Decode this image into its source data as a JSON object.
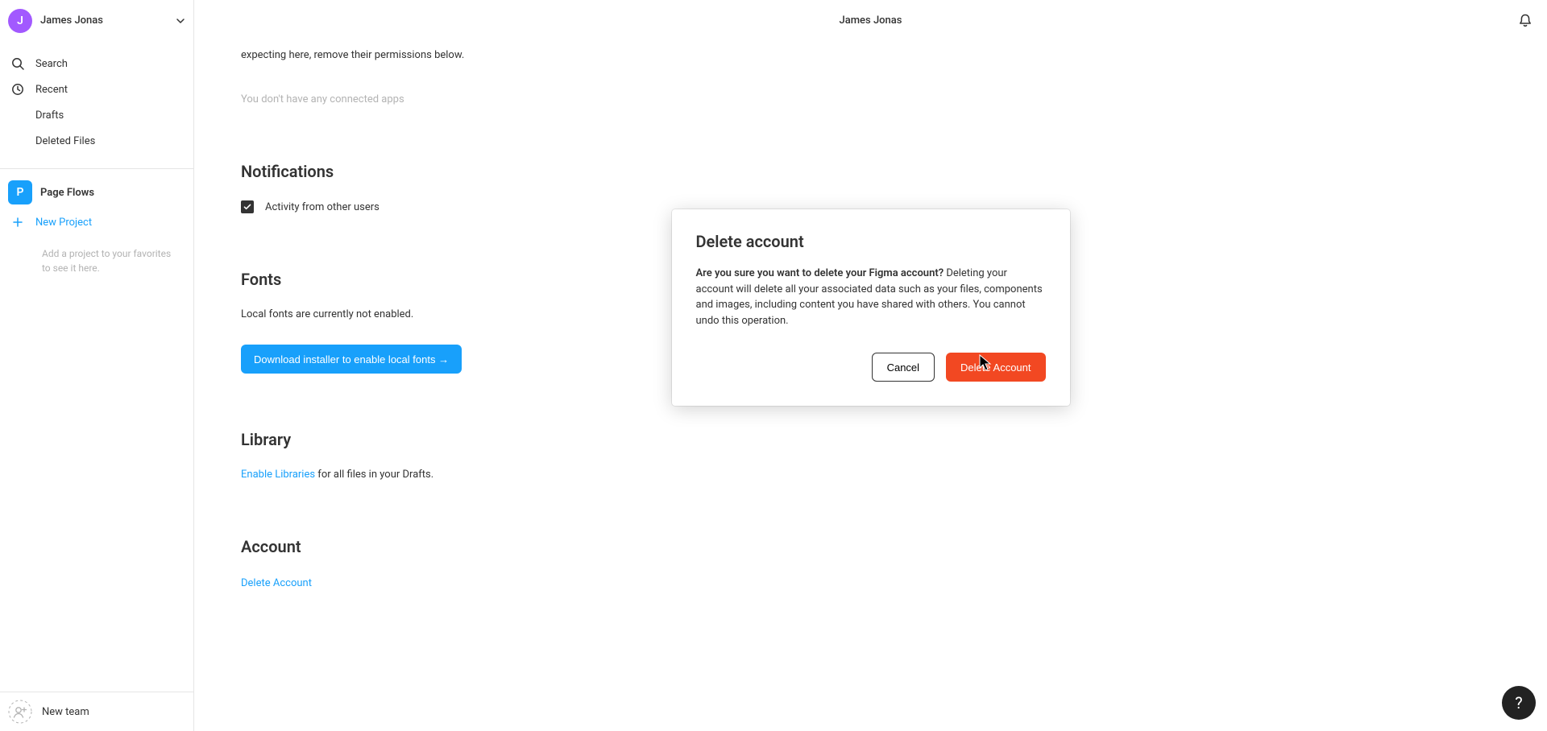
{
  "user": {
    "name": "James Jonas",
    "initial": "J"
  },
  "sidebar": {
    "nav": [
      {
        "label": "Search"
      },
      {
        "label": "Recent"
      },
      {
        "label": "Drafts"
      },
      {
        "label": "Deleted Files"
      }
    ],
    "team": {
      "name": "Page Flows",
      "initial": "P"
    },
    "new_project": "New Project",
    "empty_hint": "Add a project to your favorites to see it here.",
    "new_team": "New team"
  },
  "topbar": {
    "title": "James Jonas"
  },
  "page": {
    "apps": {
      "truncated": "expecting here, remove their permissions below.",
      "empty": "You don't have any connected apps"
    },
    "notifications": {
      "heading": "Notifications",
      "activity_label": "Activity from other users",
      "activity_checked": true
    },
    "fonts": {
      "heading": "Fonts",
      "status": "Local fonts are currently not enabled.",
      "download_btn": "Download installer to enable local fonts →"
    },
    "library": {
      "heading": "Library",
      "enable_link": "Enable Libraries",
      "suffix": " for all files in your Drafts."
    },
    "account": {
      "heading": "Account",
      "delete_link": "Delete Account"
    }
  },
  "modal": {
    "title": "Delete account",
    "question": "Are you sure you want to delete your Figma account?",
    "body": " Deleting your account will delete all your associated data such as your files, components and images, including content you have shared with others. You cannot undo this operation.",
    "cancel": "Cancel",
    "confirm": "Delete Account"
  },
  "help": {
    "label": "?"
  }
}
